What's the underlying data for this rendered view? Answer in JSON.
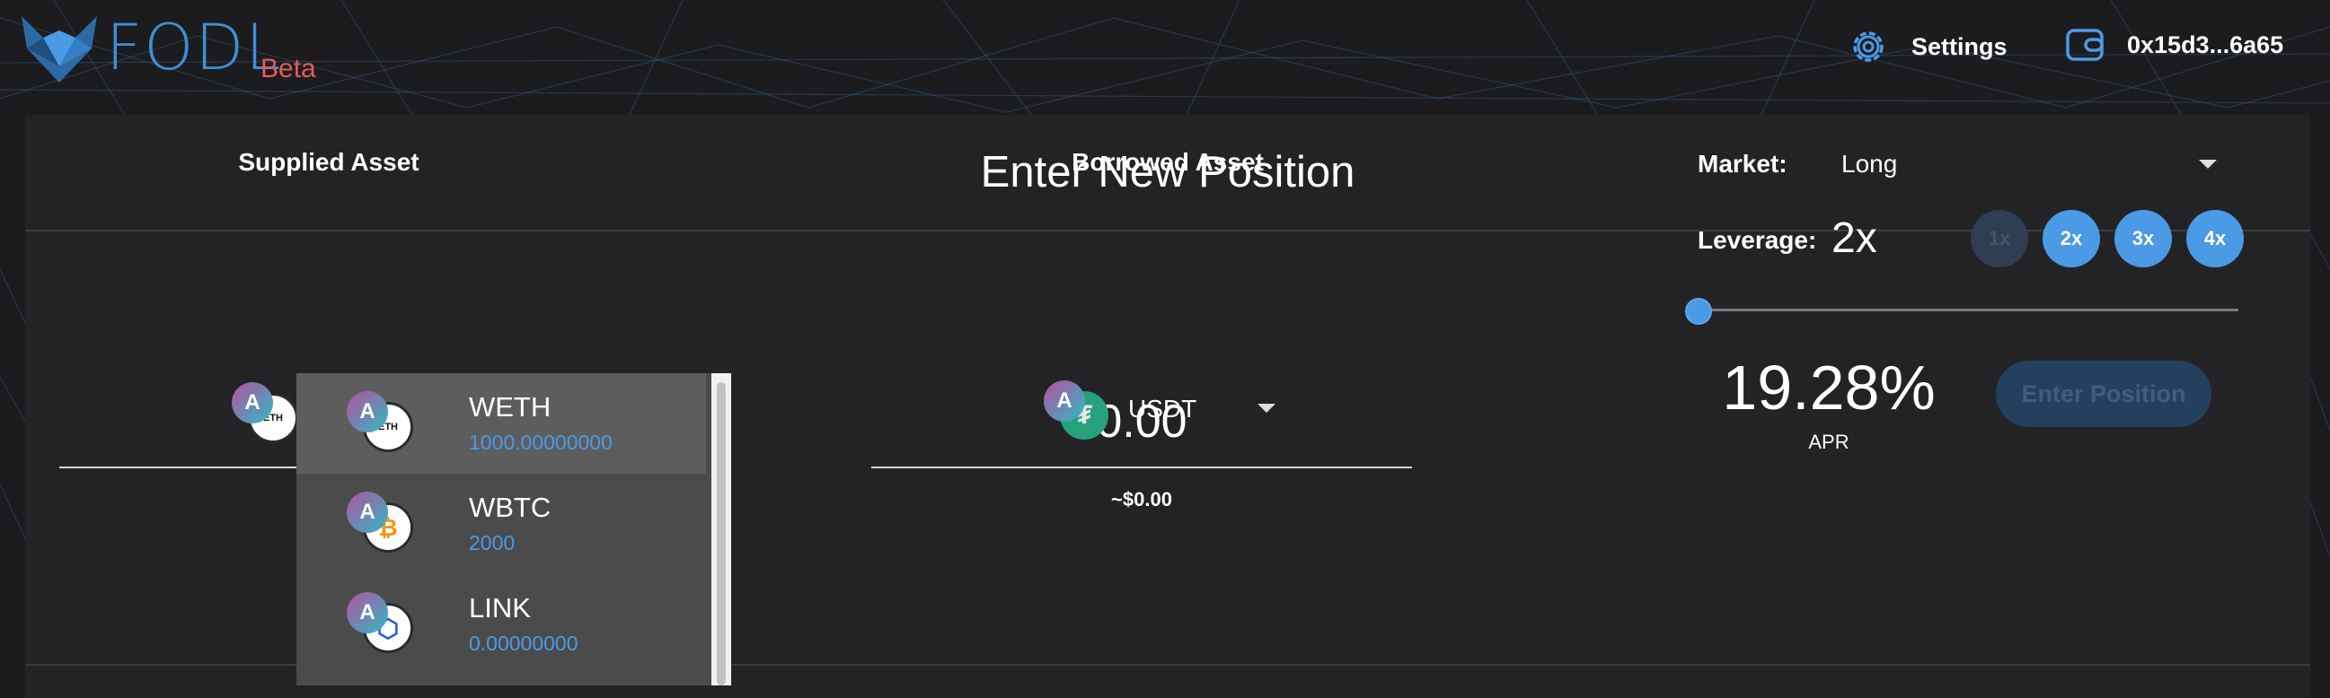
{
  "header": {
    "logo_text": "FODL",
    "beta": "Beta",
    "settings_label": "Settings",
    "wallet_address": "0x15d3...6a65"
  },
  "panel": {
    "title": "Enter New Position",
    "supplied_label": "Supplied Asset",
    "borrowed_label": "Borrowed Asset",
    "borrowed_asset": "USDT",
    "borrowed_amount": "0.00",
    "borrowed_usd": "~$0.00",
    "market_label": "Market:",
    "market_value": "Long",
    "leverage_label": "Leverage:",
    "leverage_value": "2x",
    "leverage_options": [
      "1x",
      "2x",
      "3x",
      "4x"
    ],
    "leverage_level_fraction": 0.0,
    "apr_value": "19.28%",
    "apr_label": "APR",
    "enter_button": "Enter Position"
  },
  "dropdown": {
    "items": [
      {
        "name": "WETH",
        "balance": "1000.00000000",
        "icon": "eth-icon"
      },
      {
        "name": "WBTC",
        "balance": "2000",
        "icon": "btc-icon"
      },
      {
        "name": "LINK",
        "balance": "0.00000000",
        "icon": "link-icon"
      }
    ]
  },
  "colors": {
    "accent": "#4a9ae6",
    "brand": "#3d8fd6",
    "beta": "#e45a5a",
    "background": "#1c1c1e"
  }
}
